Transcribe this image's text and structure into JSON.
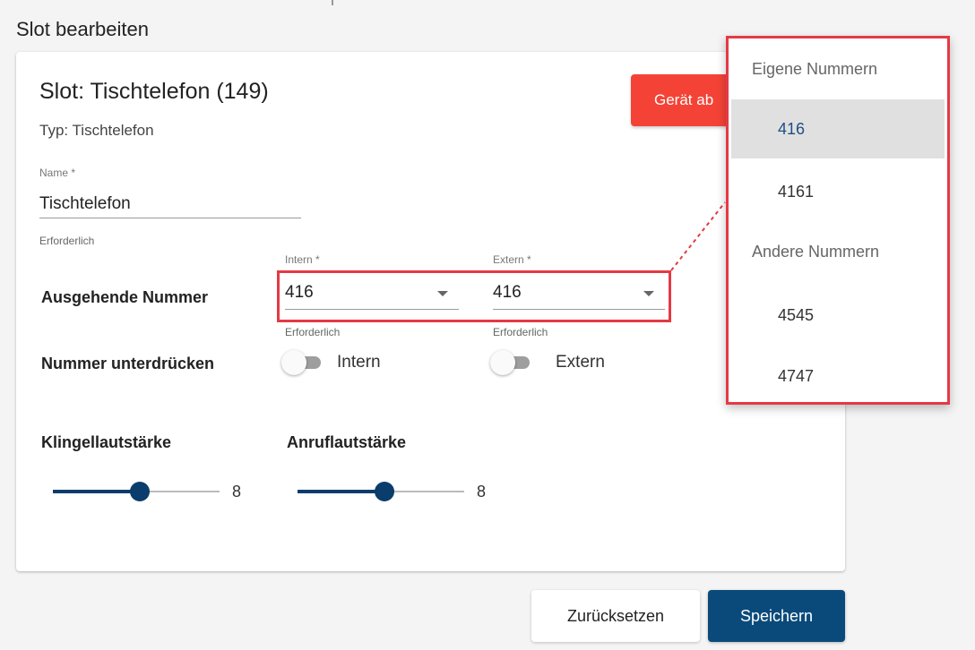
{
  "page": {
    "title": "Slot bearbeiten"
  },
  "slot": {
    "title": "Slot: Tischtelefon (149)",
    "type": "Typ: Tischtelefon",
    "device_button_label": "Gerät ab"
  },
  "name_field": {
    "label": "Name *",
    "value": "Tischtelefon",
    "hint": "Erforderlich"
  },
  "outgoing": {
    "label": "Ausgehende Nummer",
    "intern": {
      "label": "Intern *",
      "value": "416",
      "hint": "Erforderlich"
    },
    "extern": {
      "label": "Extern *",
      "value": "416",
      "hint": "Erforderlich"
    }
  },
  "suppress": {
    "label": "Nummer unterdrücken",
    "intern_label": "Intern",
    "extern_label": "Extern",
    "intern_on": false,
    "extern_on": false
  },
  "volumes": {
    "ring": {
      "label": "Klingellautstärke",
      "value": "8",
      "fraction": 0.52
    },
    "call": {
      "label": "Anruflautstärke",
      "value": "8",
      "fraction": 0.52
    }
  },
  "actions": {
    "reset_label": "Zurücksetzen",
    "save_label": "Speichern"
  },
  "dropdown": {
    "group_own": "Eigene Nummern",
    "group_other": "Andere Nummern",
    "own_items": [
      "416",
      "4161"
    ],
    "other_items": [
      "4545",
      "4747"
    ],
    "selected": "416"
  },
  "colors": {
    "primary": "#0a4a7a",
    "danger": "#f44336",
    "highlight": "#e53945"
  }
}
